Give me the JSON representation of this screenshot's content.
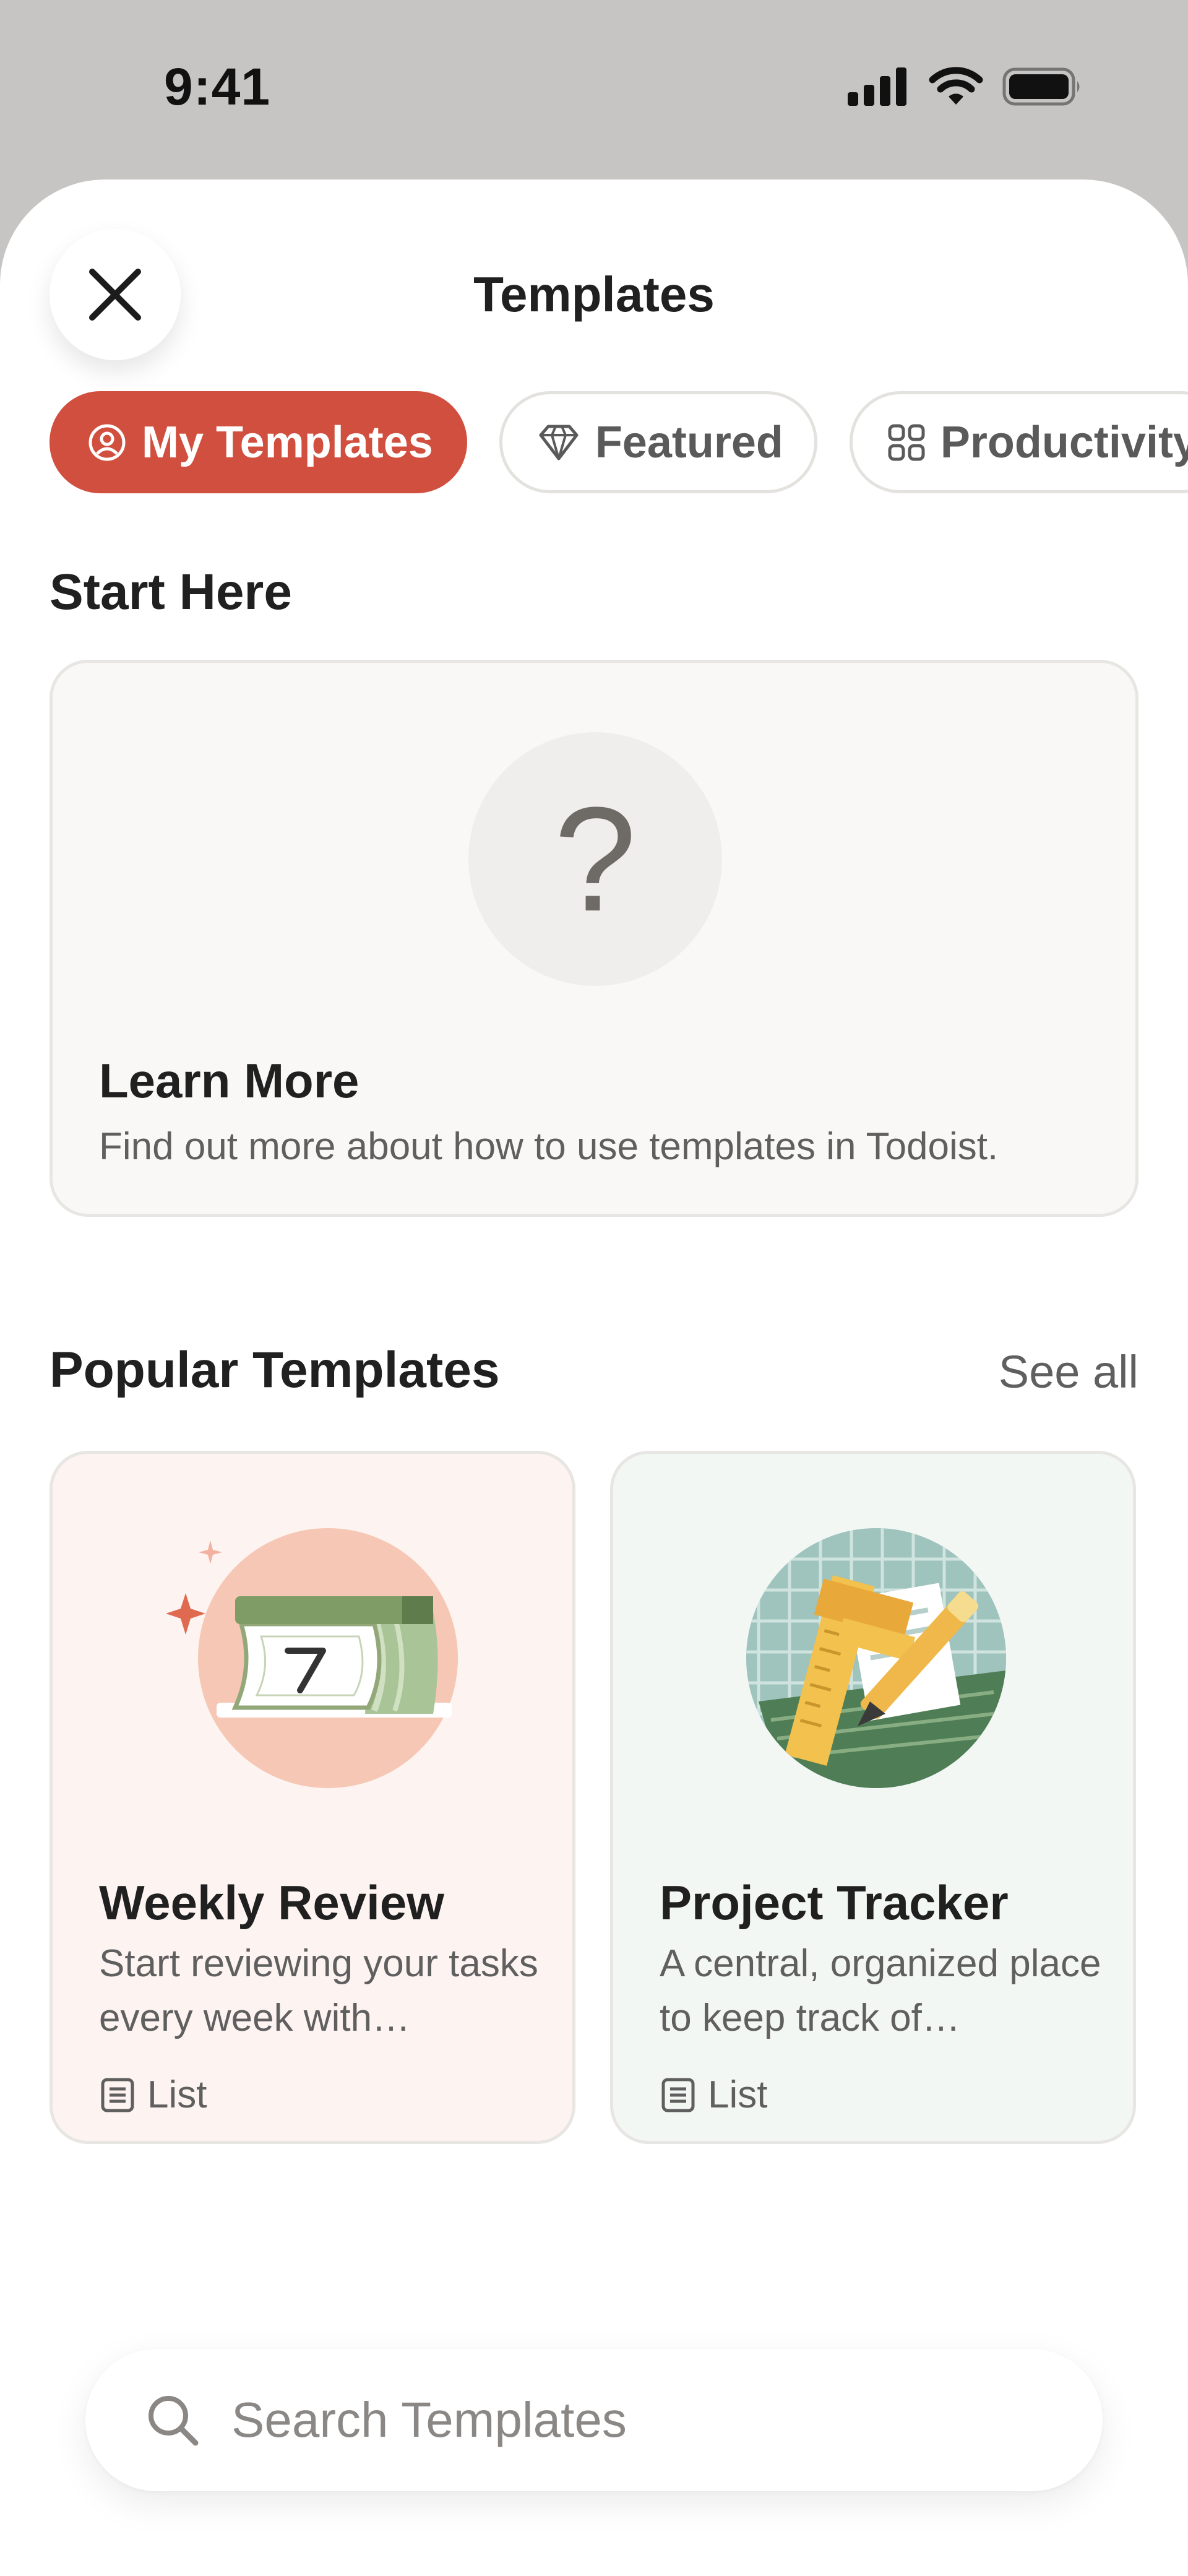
{
  "status_bar": {
    "time": "9:41"
  },
  "sheet": {
    "title": "Templates"
  },
  "tabs": [
    {
      "label": "My Templates",
      "icon": "user-circle-icon",
      "active": true
    },
    {
      "label": "Featured",
      "icon": "gem-icon",
      "active": false
    },
    {
      "label": "Productivity",
      "icon": "grid-icon",
      "active": false
    }
  ],
  "start_here": {
    "title": "Start Here",
    "card": {
      "icon_text": "?",
      "title": "Learn More",
      "description": "Find out more about how to use templates in Todoist."
    }
  },
  "popular": {
    "title": "Popular Templates",
    "see_all": "See all",
    "items": [
      {
        "title": "Weekly Review",
        "description": "Start reviewing your tasks every week with…",
        "type": "List",
        "illustration": "calendar-illustration"
      },
      {
        "title": "Project Tracker",
        "description": "A central, organized place to keep track of…",
        "type": "List",
        "illustration": "ruler-pencil-illustration"
      }
    ]
  },
  "search": {
    "placeholder": "Search Templates"
  },
  "colors": {
    "accent": "#d14f3f",
    "background": "#c6c5c4"
  }
}
